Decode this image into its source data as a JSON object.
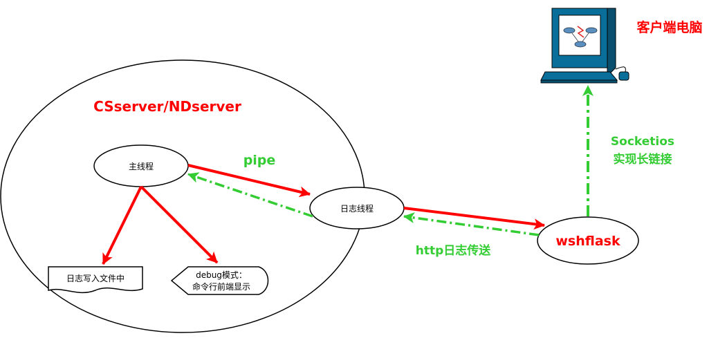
{
  "colors": {
    "red": "#ff0000",
    "green": "#33cc33",
    "black": "#000000",
    "screen_blue": "#0a6e9a"
  },
  "server": {
    "title": "CSserver/NDserver",
    "main_thread": "主线程",
    "log_thread": "日志线程",
    "write_file": "日志写入文件中",
    "debug_line1": "debug模式：",
    "debug_line2": "命令行前端显示"
  },
  "wshflask": "wshflask",
  "client": {
    "title": "客户端电脑",
    "icon": "computer-workstation-icon"
  },
  "labels": {
    "pipe": "pipe",
    "http": "http日志传送",
    "socketio_line1": "Socketios",
    "socketio_line2": "实现长链接"
  }
}
